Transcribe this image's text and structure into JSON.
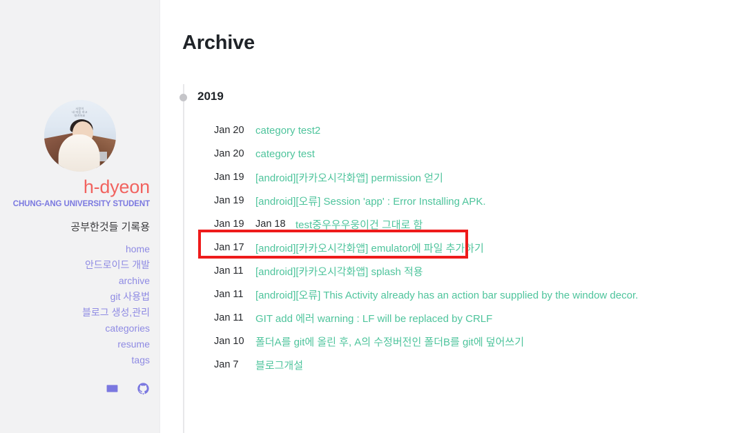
{
  "sidebar": {
    "avatar_alt": "profile-photo",
    "avatar_overlay_text": "사랑이\n내 마음 하고\n대려하요",
    "site_name": "h-dyeon",
    "site_subtitle": "CHUNG-ANG UNIVERSITY STUDENT",
    "tagline": "공부한것들 기록용",
    "nav": [
      {
        "label": "home",
        "name": "nav-home"
      },
      {
        "label": "안드로이드 개발",
        "name": "nav-android"
      },
      {
        "label": "archive",
        "name": "nav-archive"
      },
      {
        "label": "git 사용법",
        "name": "nav-git"
      },
      {
        "label": "블로그 생성,관리",
        "name": "nav-blog"
      },
      {
        "label": "categories",
        "name": "nav-categories"
      },
      {
        "label": "resume",
        "name": "nav-resume"
      },
      {
        "label": "tags",
        "name": "nav-tags"
      }
    ],
    "socials": [
      {
        "icon": "email-icon",
        "name": "social-email"
      },
      {
        "icon": "github-icon",
        "name": "social-github"
      }
    ]
  },
  "main": {
    "page_title": "Archive",
    "year": "2019",
    "posts": [
      {
        "date": "Jan 20",
        "date2": "",
        "title": "category test2"
      },
      {
        "date": "Jan 20",
        "date2": "",
        "title": "category test"
      },
      {
        "date": "Jan 19",
        "date2": "",
        "title": "[android][카카오시각화앱] permission 얻기"
      },
      {
        "date": "Jan 19",
        "date2": "",
        "title": "[android][오류] Session 'app' : Error Installing APK."
      },
      {
        "date": "Jan 19",
        "date2": "Jan 18",
        "title": "test중우우우웅이건 그대로 함"
      },
      {
        "date": "Jan 17",
        "date2": "",
        "title": "[android][카카오시각화앱] emulator에 파일 추가하기"
      },
      {
        "date": "Jan 11",
        "date2": "",
        "title": "[android][카카오시각화앱] splash 적용"
      },
      {
        "date": "Jan 11",
        "date2": "",
        "title": "[android][오류] This Activity already has an action bar supplied by the window decor."
      },
      {
        "date": "Jan 11",
        "date2": "",
        "title": "GIT add 에러 warning : LF will be replaced by CRLF"
      },
      {
        "date": "Jan 10",
        "date2": "",
        "title": "폴더A를 git에 올린 후, A의 수정버전인 폴더B를 git에 덮어쓰기"
      },
      {
        "date": "Jan 7",
        "date2": "",
        "title": "블로그개설"
      }
    ],
    "annotation": {
      "target_row_index": 4,
      "color": "#ee1b1b"
    }
  },
  "colors": {
    "link_green": "#4ec49c",
    "name_coral": "#f1635f",
    "nav_purple": "#8e8ae3",
    "subtitle_purple": "#7b79e0",
    "sidebar_bg": "#f2f2f3",
    "annotation_red": "#ee1b1b"
  }
}
